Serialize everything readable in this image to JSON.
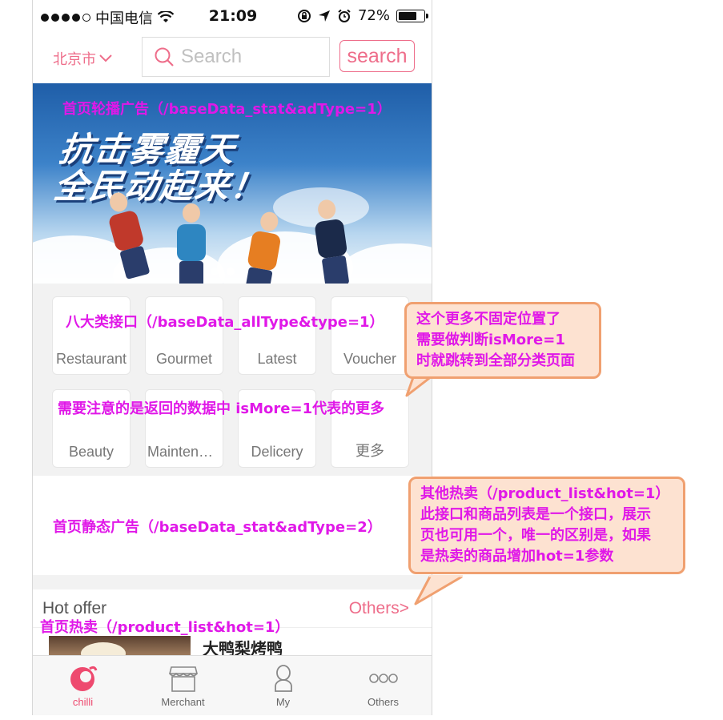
{
  "status_bar": {
    "carrier": "中国电信",
    "time": "21:09",
    "battery": "72%",
    "battery_level": 0.72
  },
  "top_bar": {
    "city": "北京市",
    "search_placeholder": "Search",
    "search_button": "search"
  },
  "banner": {
    "title_line1": "抗击雾霾天",
    "title_line2": "全民动起来！",
    "annotation": "首页轮播广告（/baseData_stat&adType=1）"
  },
  "categories": {
    "annotation": "八大类接口（/baseData_allType&type=1）",
    "note": "需要注意的是返回的数据中 isMore=1代表的更多",
    "items": [
      {
        "label": "Restaurant"
      },
      {
        "label": "Gourmet"
      },
      {
        "label": "Latest"
      },
      {
        "label": "Voucher"
      },
      {
        "label": "Beauty"
      },
      {
        "label": "Maintena…"
      },
      {
        "label": "Delicery"
      },
      {
        "label": "更多"
      }
    ]
  },
  "static_ad": {
    "annotation": "首页静态广告（/baseData_stat&adType=2）"
  },
  "hot_offer": {
    "title": "Hot offer",
    "more": "Others>",
    "annotation": "首页热卖（/product_list&hot=1）",
    "product_name": "大鸭梨烤鸭"
  },
  "tabs": [
    {
      "label": "chilli",
      "icon": "chilli-icon"
    },
    {
      "label": "Merchant",
      "icon": "store-icon"
    },
    {
      "label": "My",
      "icon": "person-icon"
    },
    {
      "label": "Others",
      "icon": "more-dots-icon"
    }
  ],
  "callouts": {
    "more": [
      "这个更多不固定位置了",
      "需要做判断isMore=1",
      "时就跳转到全部分类页面"
    ],
    "hot": [
      "其他热卖（/product_list&hot=1）",
      "此接口和商品列表是一个接口，展示",
      "页也可用一个，唯一的区别是，如果",
      "是热卖的商品增加hot=1参数"
    ]
  },
  "colors": {
    "accent": "#ee6d8a",
    "annotation": "#e018e8",
    "callout_bg": "#fde2d1",
    "callout_border": "#f0a070"
  }
}
